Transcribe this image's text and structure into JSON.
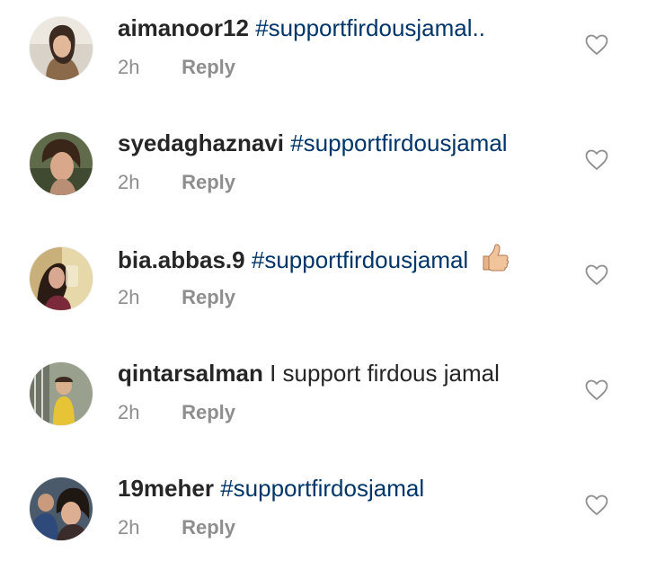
{
  "comments": [
    {
      "username": "aimanoor12",
      "text": "#supportfirdousjamal..",
      "text_style": "hashtag",
      "time": "2h",
      "reply_label": "Reply",
      "like_icon": "heart-outline-icon"
    },
    {
      "username": "syedaghaznavi",
      "text": "#supportfirdousjamal",
      "text_style": "hashtag",
      "time": "2h",
      "reply_label": "Reply",
      "like_icon": "heart-outline-icon"
    },
    {
      "username": "bia.abbas.9",
      "text": "#supportfirdousjamal",
      "text_style": "hashtag",
      "emoji": "thumbs-up-emoji",
      "time": "2h",
      "reply_label": "Reply",
      "like_icon": "heart-outline-icon"
    },
    {
      "username": "qintarsalman",
      "text": "I support firdous jamal",
      "text_style": "plain",
      "time": "2h",
      "reply_label": "Reply",
      "like_icon": "heart-outline-icon"
    },
    {
      "username": "19meher",
      "text": "#supportfirdosjamal",
      "text_style": "hashtag",
      "time": "2h",
      "reply_label": "Reply",
      "like_icon": "heart-outline-icon"
    }
  ],
  "colors": {
    "username": "#262626",
    "hashtag": "#003569",
    "meta": "#8e8e8e",
    "background": "#ffffff"
  }
}
